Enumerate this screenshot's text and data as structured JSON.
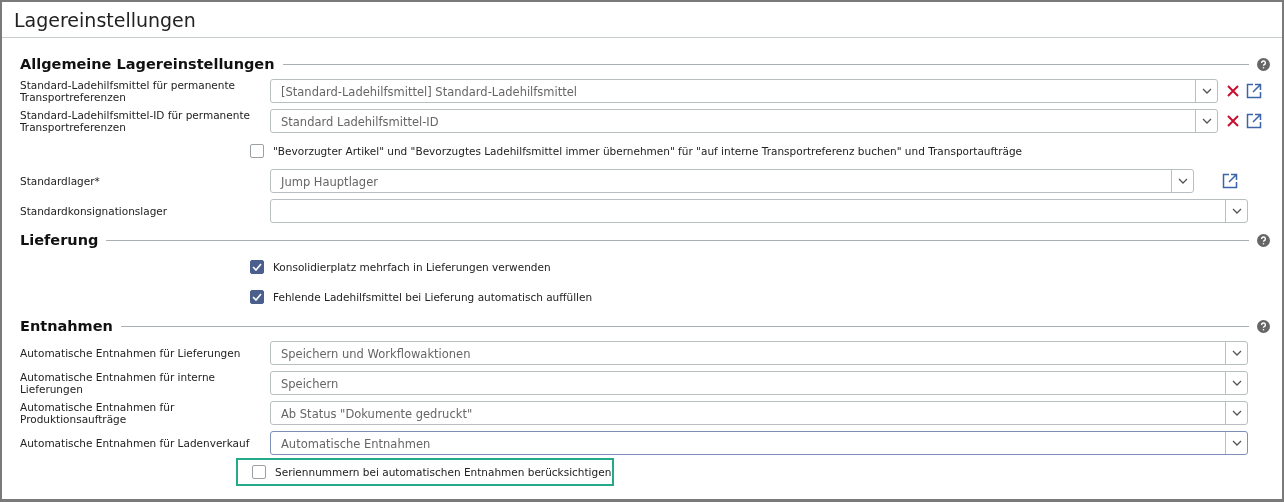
{
  "window": {
    "title": "Lagereinstellungen"
  },
  "sections": [
    {
      "title": "Allgemeine Lagereinstellungen",
      "rows": [
        {
          "kind": "select",
          "label": "Standard-Ladehilfsmittel für permanente Transportreferenzen",
          "value": "[Standard-Ladehilfsmittel] Standard-Ladehilfsmittel",
          "clearable": true,
          "openable": true,
          "focused": false
        },
        {
          "kind": "select",
          "label": "Standard-Ladehilfsmittel-ID für permanente Transportreferenzen",
          "value": "Standard Ladehilfsmittel-ID",
          "clearable": true,
          "openable": true,
          "focused": false
        },
        {
          "kind": "checkbox",
          "label": "\"Bevorzugter Artikel\" und \"Bevorzugtes Ladehilfsmittel immer übernehmen\" für \"auf interne Transportreferenz buchen\" und Transportaufträge",
          "checked": false,
          "highlighted": false
        },
        {
          "kind": "select",
          "label": "Standardlager*",
          "value": "Jump Hauptlager",
          "clearable": false,
          "openable": true,
          "focused": false
        },
        {
          "kind": "select",
          "label": "Standardkonsignationslager",
          "clearable": false,
          "openable": false,
          "focused": false
        }
      ]
    },
    {
      "title": "Lieferung",
      "rows": [
        {
          "kind": "checkbox",
          "label": "Konsolidierplatz mehrfach in Lieferungen verwenden",
          "checked": true,
          "highlighted": false
        },
        {
          "kind": "checkbox",
          "label": "Fehlende Ladehilfsmittel bei Lieferung automatisch auffüllen",
          "checked": true,
          "highlighted": false
        }
      ]
    },
    {
      "title": "Entnahmen",
      "rows": [
        {
          "kind": "select",
          "label": "Automatische Entnahmen für Lieferungen",
          "value": "Speichern und Workflowaktionen",
          "clearable": false,
          "openable": false,
          "focused": false
        },
        {
          "kind": "select",
          "label": "Automatische Entnahmen für interne Lieferungen",
          "value": "Speichern",
          "clearable": false,
          "openable": false,
          "focused": false
        },
        {
          "kind": "select",
          "label": "Automatische Entnahmen für Produktionsaufträge",
          "value": "Ab Status \"Dokumente gedruckt\"",
          "clearable": false,
          "openable": false,
          "focused": false
        },
        {
          "kind": "select",
          "label": "Automatische Entnahmen für Ladenverkauf",
          "value": "Automatische Entnahmen",
          "clearable": false,
          "openable": false,
          "focused": true
        },
        {
          "kind": "checkbox",
          "label": "Seriennummern bei automatischen Entnahmen berücksichtigen",
          "checked": false,
          "highlighted": true
        }
      ]
    }
  ]
}
